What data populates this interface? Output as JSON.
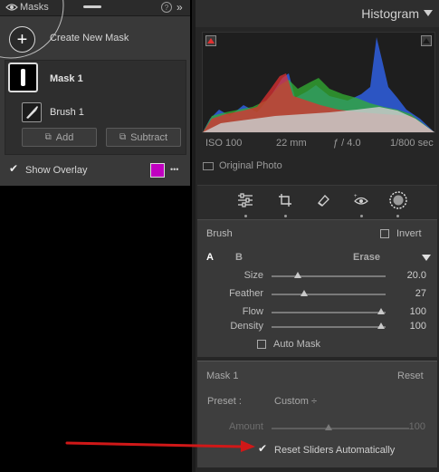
{
  "masks": {
    "title": "Masks",
    "create_new_label": "Create New Mask",
    "items": [
      {
        "label": "Mask 1"
      },
      {
        "label": "Brush 1"
      }
    ],
    "add_label": "Add",
    "subtract_label": "Subtract",
    "show_overlay_label": "Show Overlay",
    "overlay_color": "#c000c0",
    "more_label": "•••"
  },
  "histogram": {
    "title": "Histogram",
    "iso": "ISO 100",
    "focal_length": "22 mm",
    "aperture": "ƒ / 4.0",
    "shutter": "1/800 sec",
    "original_photo_label": "Original Photo",
    "colors": {
      "red": "#e03030",
      "green": "#33b033",
      "blue": "#2f5fe0",
      "gray": "#c9c9c9"
    }
  },
  "brush": {
    "title": "Brush",
    "invert_label": "Invert",
    "tab_a": "A",
    "tab_b": "B",
    "erase_label": "Erase",
    "sliders": [
      {
        "label": "Size",
        "value": "20.0",
        "pos": 0.22
      },
      {
        "label": "Feather",
        "value": "27",
        "pos": 0.27
      },
      {
        "label": "Flow",
        "value": "100",
        "pos": 1.0
      },
      {
        "label": "Density",
        "value": "100",
        "pos": 1.0
      }
    ],
    "auto_mask_label": "Auto Mask"
  },
  "mask_settings": {
    "title": "Mask 1",
    "reset_label": "Reset",
    "preset_label": "Preset :",
    "preset_value": "Custom ÷",
    "amount_label": "Amount",
    "amount_value": "100",
    "amount_pos": 0.5,
    "reset_sliders_label": "Reset Sliders Automatically"
  },
  "annotation": {
    "arrow_color": "#d01818"
  }
}
